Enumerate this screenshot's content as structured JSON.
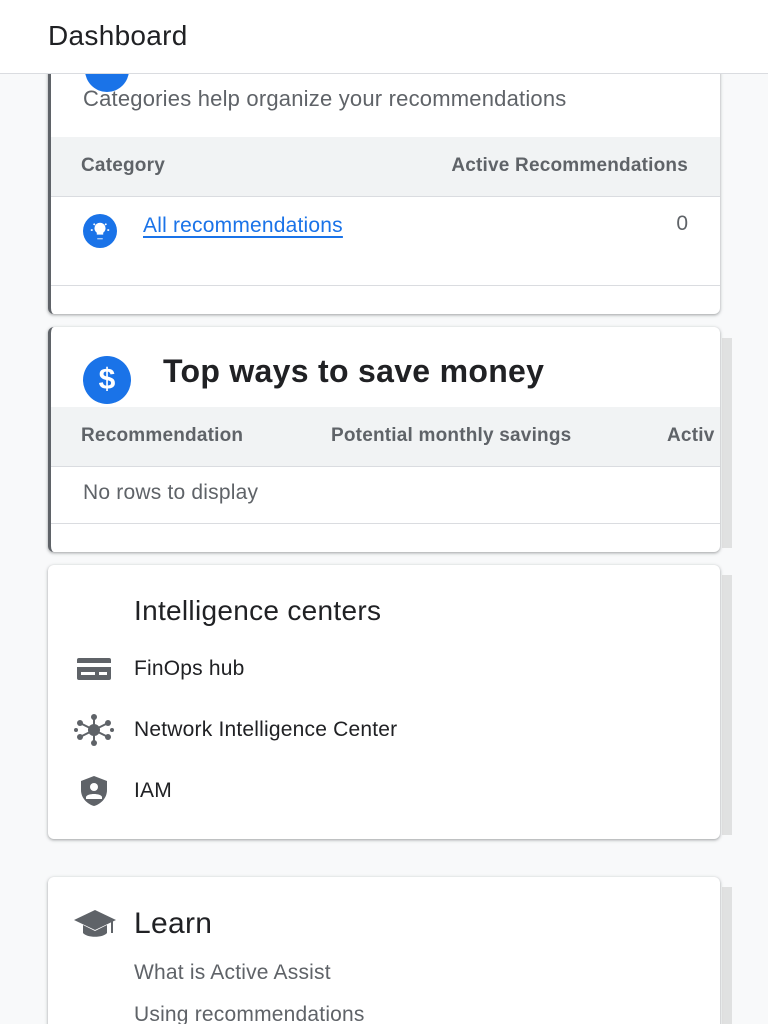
{
  "header": {
    "title": "Dashboard"
  },
  "categories_card": {
    "subtitle": "Categories help organize your recommendations",
    "columns": [
      "Category",
      "Active Recommendations"
    ],
    "rows": [
      {
        "icon": "lightbulb-icon",
        "label": "All recommendations",
        "count": "0"
      }
    ]
  },
  "savings_card": {
    "icon": "dollar-icon",
    "title": "Top ways to save money",
    "columns": [
      "Recommendation",
      "Potential monthly savings",
      "Activ"
    ],
    "empty_text": "No rows to display"
  },
  "intelligence_card": {
    "title": "Intelligence centers",
    "items": [
      {
        "icon": "billing-card-icon",
        "label": "FinOps hub"
      },
      {
        "icon": "network-hub-icon",
        "label": "Network Intelligence Center"
      },
      {
        "icon": "shield-user-icon",
        "label": "IAM"
      }
    ]
  },
  "learn_card": {
    "icon": "graduation-cap-icon",
    "title": "Learn",
    "links": [
      "What is Active Assist",
      "Using recommendations"
    ]
  },
  "colors": {
    "accent": "#1a73e8",
    "muted_text": "#5f6368",
    "header_bg": "#f1f3f4"
  }
}
